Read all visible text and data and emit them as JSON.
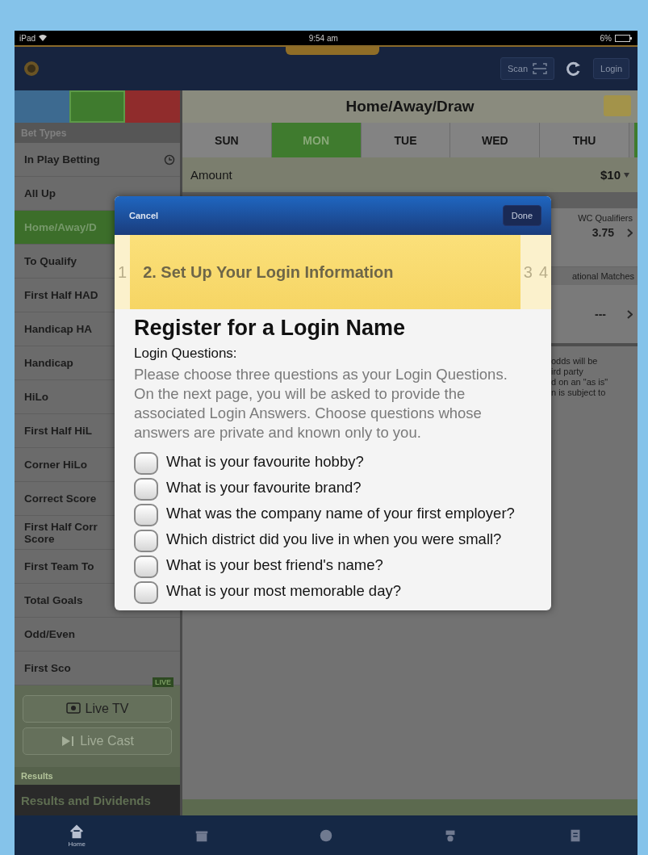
{
  "status_bar": {
    "carrier": "iPad",
    "time": "9:54 am",
    "battery": "6%"
  },
  "header": {
    "scan": "Scan",
    "login": "Login"
  },
  "sidebar": {
    "sports": [
      {
        "color": "#3d6a90",
        "selected": false
      },
      {
        "color": "#3f7b2e",
        "selected": true
      },
      {
        "color": "#902c2c",
        "selected": false
      }
    ],
    "section": "Bet Types",
    "items": [
      {
        "label": "In Play Betting",
        "kind": "timed",
        "selected": false
      },
      {
        "label": "All Up",
        "kind": "plain",
        "selected": false
      },
      {
        "label": "Home/Away/D",
        "kind": "plain",
        "selected": true
      },
      {
        "label": "To Qualify",
        "kind": "plain",
        "selected": false
      },
      {
        "label": "First Half HAD",
        "kind": "plain",
        "selected": false
      },
      {
        "label": "Handicap HA",
        "kind": "plain",
        "selected": false
      },
      {
        "label": "Handicap",
        "kind": "plain",
        "selected": false
      },
      {
        "label": "HiLo",
        "kind": "plain",
        "selected": false
      },
      {
        "label": "First Half HiL",
        "kind": "plain",
        "selected": false
      },
      {
        "label": "Corner HiLo",
        "kind": "plain",
        "selected": false
      },
      {
        "label": "Correct Score",
        "kind": "plain",
        "selected": false
      },
      {
        "label": "First Half Corr Score",
        "kind": "plain",
        "selected": false
      },
      {
        "label": "First Team To",
        "kind": "plain",
        "selected": false
      },
      {
        "label": "Total Goals",
        "kind": "plain",
        "selected": false
      },
      {
        "label": "Odd/Even",
        "kind": "plain",
        "selected": false
      },
      {
        "label": "First Sco",
        "kind": "plain",
        "selected": false
      }
    ],
    "live_badge": "LIVE",
    "buttons": [
      {
        "label": "Live TV",
        "disabled": false
      },
      {
        "label": "Live Cast",
        "disabled": true
      }
    ],
    "results_header": "Results",
    "results_item": "Results and Dividends"
  },
  "main": {
    "title": "Home/Away/Draw",
    "days": [
      {
        "label": "SUN",
        "selected": false
      },
      {
        "label": "MON",
        "selected": true
      },
      {
        "label": "TUE",
        "selected": false
      },
      {
        "label": "WED",
        "selected": false
      },
      {
        "label": "THU",
        "selected": false
      }
    ],
    "amount": {
      "label": "Amount",
      "value": "$10"
    },
    "markets": [
      {
        "name": "WC Qualifiers",
        "odds": "3.75"
      },
      {
        "name": "ational Matches",
        "odds": "---"
      }
    ],
    "notice_lines": [
      "odds will be",
      "ird party",
      "d on an \"as is\"",
      "n is subject to"
    ]
  },
  "dialog": {
    "cancel": "Cancel",
    "done": "Done",
    "steps": [
      {
        "label": "1",
        "selected": false
      },
      {
        "label": "2. Set Up Your Login Information",
        "selected": true
      },
      {
        "label": "3",
        "selected": false
      },
      {
        "label": "4",
        "selected": false
      }
    ],
    "title": "Register for a Login Name",
    "subtitle": "Login Questions:",
    "instructions": "Please choose three questions as your Login Questions. On the next page, you will be asked to provide the associated Login Answers. Choose questions whose answers are private and known only to you.",
    "questions": [
      {
        "text": "What is your favourite hobby?",
        "checked": false
      },
      {
        "text": "What is your favourite brand?",
        "checked": false
      },
      {
        "text": "What was the company name of your first employer?",
        "checked": false
      },
      {
        "text": "Which district did you live in when you were small?",
        "checked": false
      },
      {
        "text": "What is your best friend's name?",
        "checked": false
      },
      {
        "text": "What is your most memorable day?",
        "checked": false
      }
    ]
  },
  "tab_bar": {
    "tabs": [
      {
        "label": "Home",
        "selected": true
      },
      {
        "selected": false
      },
      {
        "selected": false
      },
      {
        "selected": false
      },
      {
        "selected": false
      }
    ]
  }
}
